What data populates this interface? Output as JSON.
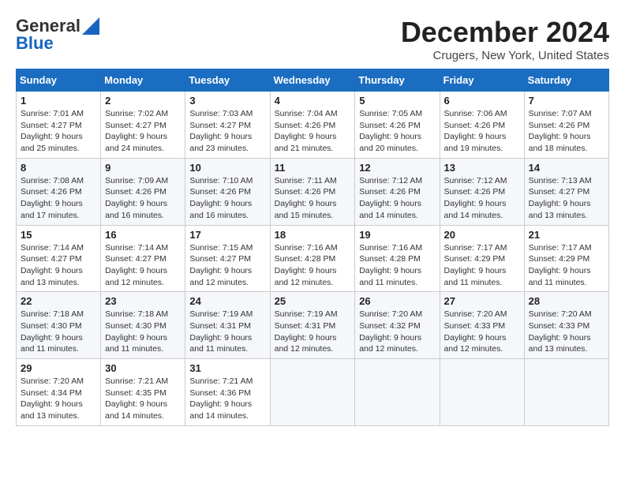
{
  "header": {
    "logo_general": "General",
    "logo_blue": "Blue",
    "month": "December 2024",
    "location": "Crugers, New York, United States"
  },
  "days_of_week": [
    "Sunday",
    "Monday",
    "Tuesday",
    "Wednesday",
    "Thursday",
    "Friday",
    "Saturday"
  ],
  "weeks": [
    [
      {
        "day": "1",
        "sunrise": "Sunrise: 7:01 AM",
        "sunset": "Sunset: 4:27 PM",
        "daylight": "Daylight: 9 hours and 25 minutes."
      },
      {
        "day": "2",
        "sunrise": "Sunrise: 7:02 AM",
        "sunset": "Sunset: 4:27 PM",
        "daylight": "Daylight: 9 hours and 24 minutes."
      },
      {
        "day": "3",
        "sunrise": "Sunrise: 7:03 AM",
        "sunset": "Sunset: 4:27 PM",
        "daylight": "Daylight: 9 hours and 23 minutes."
      },
      {
        "day": "4",
        "sunrise": "Sunrise: 7:04 AM",
        "sunset": "Sunset: 4:26 PM",
        "daylight": "Daylight: 9 hours and 21 minutes."
      },
      {
        "day": "5",
        "sunrise": "Sunrise: 7:05 AM",
        "sunset": "Sunset: 4:26 PM",
        "daylight": "Daylight: 9 hours and 20 minutes."
      },
      {
        "day": "6",
        "sunrise": "Sunrise: 7:06 AM",
        "sunset": "Sunset: 4:26 PM",
        "daylight": "Daylight: 9 hours and 19 minutes."
      },
      {
        "day": "7",
        "sunrise": "Sunrise: 7:07 AM",
        "sunset": "Sunset: 4:26 PM",
        "daylight": "Daylight: 9 hours and 18 minutes."
      }
    ],
    [
      {
        "day": "8",
        "sunrise": "Sunrise: 7:08 AM",
        "sunset": "Sunset: 4:26 PM",
        "daylight": "Daylight: 9 hours and 17 minutes."
      },
      {
        "day": "9",
        "sunrise": "Sunrise: 7:09 AM",
        "sunset": "Sunset: 4:26 PM",
        "daylight": "Daylight: 9 hours and 16 minutes."
      },
      {
        "day": "10",
        "sunrise": "Sunrise: 7:10 AM",
        "sunset": "Sunset: 4:26 PM",
        "daylight": "Daylight: 9 hours and 16 minutes."
      },
      {
        "day": "11",
        "sunrise": "Sunrise: 7:11 AM",
        "sunset": "Sunset: 4:26 PM",
        "daylight": "Daylight: 9 hours and 15 minutes."
      },
      {
        "day": "12",
        "sunrise": "Sunrise: 7:12 AM",
        "sunset": "Sunset: 4:26 PM",
        "daylight": "Daylight: 9 hours and 14 minutes."
      },
      {
        "day": "13",
        "sunrise": "Sunrise: 7:12 AM",
        "sunset": "Sunset: 4:26 PM",
        "daylight": "Daylight: 9 hours and 14 minutes."
      },
      {
        "day": "14",
        "sunrise": "Sunrise: 7:13 AM",
        "sunset": "Sunset: 4:27 PM",
        "daylight": "Daylight: 9 hours and 13 minutes."
      }
    ],
    [
      {
        "day": "15",
        "sunrise": "Sunrise: 7:14 AM",
        "sunset": "Sunset: 4:27 PM",
        "daylight": "Daylight: 9 hours and 13 minutes."
      },
      {
        "day": "16",
        "sunrise": "Sunrise: 7:14 AM",
        "sunset": "Sunset: 4:27 PM",
        "daylight": "Daylight: 9 hours and 12 minutes."
      },
      {
        "day": "17",
        "sunrise": "Sunrise: 7:15 AM",
        "sunset": "Sunset: 4:27 PM",
        "daylight": "Daylight: 9 hours and 12 minutes."
      },
      {
        "day": "18",
        "sunrise": "Sunrise: 7:16 AM",
        "sunset": "Sunset: 4:28 PM",
        "daylight": "Daylight: 9 hours and 12 minutes."
      },
      {
        "day": "19",
        "sunrise": "Sunrise: 7:16 AM",
        "sunset": "Sunset: 4:28 PM",
        "daylight": "Daylight: 9 hours and 11 minutes."
      },
      {
        "day": "20",
        "sunrise": "Sunrise: 7:17 AM",
        "sunset": "Sunset: 4:29 PM",
        "daylight": "Daylight: 9 hours and 11 minutes."
      },
      {
        "day": "21",
        "sunrise": "Sunrise: 7:17 AM",
        "sunset": "Sunset: 4:29 PM",
        "daylight": "Daylight: 9 hours and 11 minutes."
      }
    ],
    [
      {
        "day": "22",
        "sunrise": "Sunrise: 7:18 AM",
        "sunset": "Sunset: 4:30 PM",
        "daylight": "Daylight: 9 hours and 11 minutes."
      },
      {
        "day": "23",
        "sunrise": "Sunrise: 7:18 AM",
        "sunset": "Sunset: 4:30 PM",
        "daylight": "Daylight: 9 hours and 11 minutes."
      },
      {
        "day": "24",
        "sunrise": "Sunrise: 7:19 AM",
        "sunset": "Sunset: 4:31 PM",
        "daylight": "Daylight: 9 hours and 11 minutes."
      },
      {
        "day": "25",
        "sunrise": "Sunrise: 7:19 AM",
        "sunset": "Sunset: 4:31 PM",
        "daylight": "Daylight: 9 hours and 12 minutes."
      },
      {
        "day": "26",
        "sunrise": "Sunrise: 7:20 AM",
        "sunset": "Sunset: 4:32 PM",
        "daylight": "Daylight: 9 hours and 12 minutes."
      },
      {
        "day": "27",
        "sunrise": "Sunrise: 7:20 AM",
        "sunset": "Sunset: 4:33 PM",
        "daylight": "Daylight: 9 hours and 12 minutes."
      },
      {
        "day": "28",
        "sunrise": "Sunrise: 7:20 AM",
        "sunset": "Sunset: 4:33 PM",
        "daylight": "Daylight: 9 hours and 13 minutes."
      }
    ],
    [
      {
        "day": "29",
        "sunrise": "Sunrise: 7:20 AM",
        "sunset": "Sunset: 4:34 PM",
        "daylight": "Daylight: 9 hours and 13 minutes."
      },
      {
        "day": "30",
        "sunrise": "Sunrise: 7:21 AM",
        "sunset": "Sunset: 4:35 PM",
        "daylight": "Daylight: 9 hours and 14 minutes."
      },
      {
        "day": "31",
        "sunrise": "Sunrise: 7:21 AM",
        "sunset": "Sunset: 4:36 PM",
        "daylight": "Daylight: 9 hours and 14 minutes."
      },
      null,
      null,
      null,
      null
    ]
  ]
}
